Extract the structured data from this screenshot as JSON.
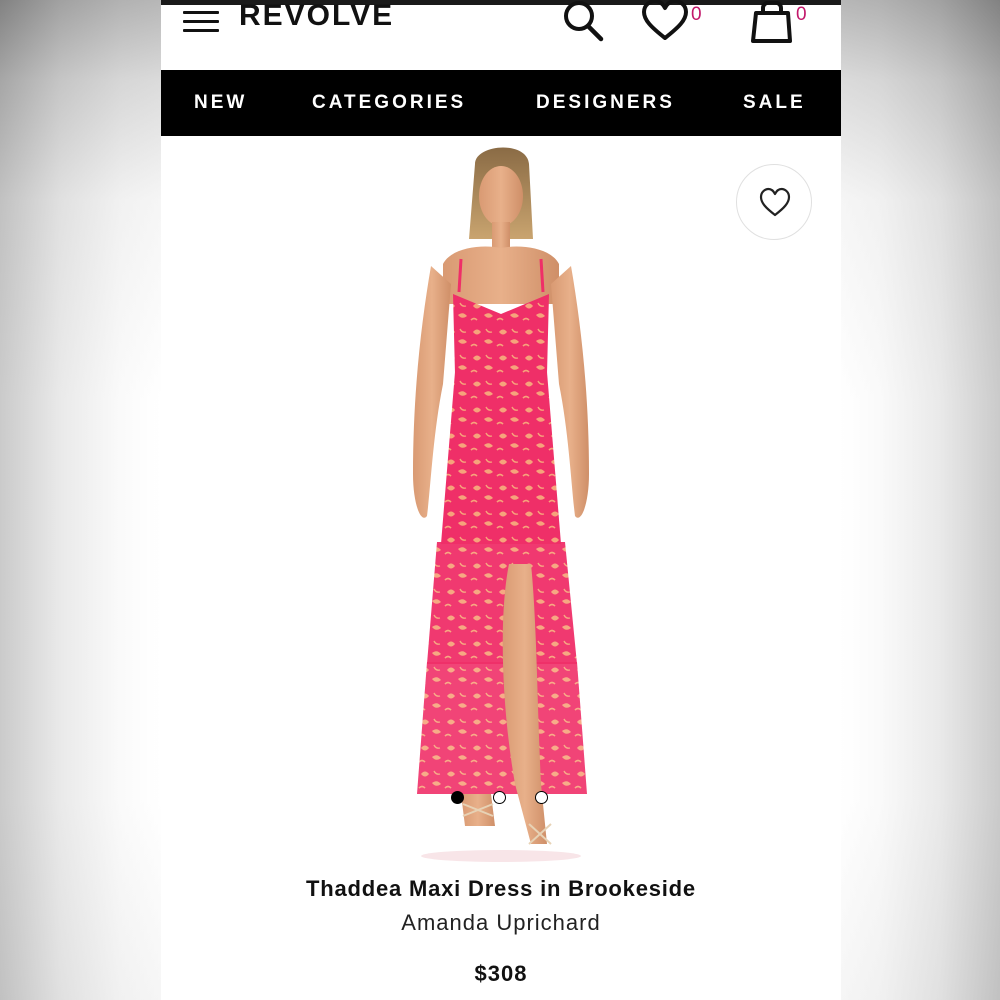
{
  "header": {
    "logo": "REVOLVE",
    "wishlist_count": "0",
    "bag_count": "0"
  },
  "nav": {
    "items": [
      "NEW",
      "CATEGORIES",
      "DESIGNERS",
      "SALE"
    ]
  },
  "product": {
    "name": "Thaddea Maxi Dress in Brookeside",
    "designer": "Amanda Uprichard",
    "price": "$308",
    "image_count": 3,
    "active_image_index": 0
  },
  "colors": {
    "accent_count": "#c2186b",
    "nav_background": "#000000",
    "dress_primary": "#f0306a",
    "dress_pattern": "#f5a07a"
  },
  "icons": [
    "menu-icon",
    "search-icon",
    "heart-icon",
    "bag-icon",
    "heart-outline-icon"
  ]
}
